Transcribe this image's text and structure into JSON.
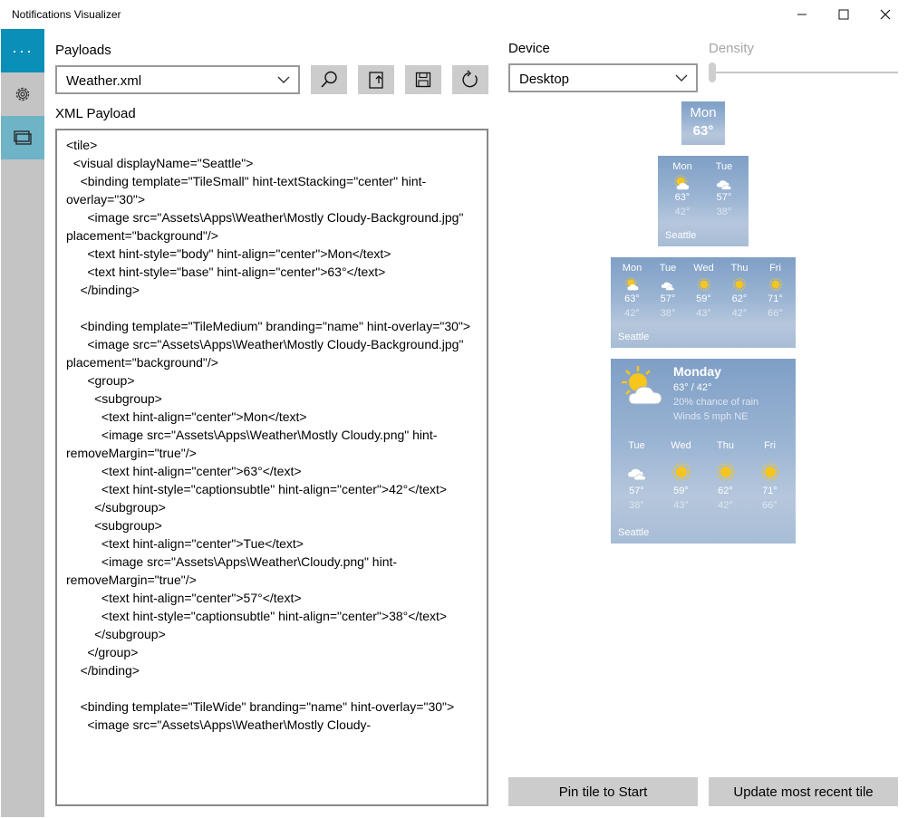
{
  "window": {
    "title": "Notifications Visualizer",
    "controls": {
      "minimize": "—",
      "maximize": "☐",
      "close": "✕"
    }
  },
  "sidebar": {
    "more_label": "···",
    "items": [
      {
        "icon": "gear-icon"
      },
      {
        "icon": "tiles-icon"
      }
    ]
  },
  "payloads": {
    "label": "Payloads",
    "selected": "Weather.xml",
    "xml_label": "XML Payload"
  },
  "device": {
    "label": "Device",
    "selected": "Desktop",
    "density_label": "Density"
  },
  "editor_lines": [
    "<tile>",
    "  <visual displayName=\"Seattle\">",
    "    <binding template=\"TileSmall\" hint-textStacking=\"center\" hint-overlay=\"30\">",
    "      <image src=\"Assets\\Apps\\Weather\\Mostly Cloudy-Background.jpg\" placement=\"background\"/>",
    "      <text hint-style=\"body\" hint-align=\"center\">Mon</text>",
    "      <text hint-style=\"base\" hint-align=\"center\">63°</text>",
    "    </binding>",
    "",
    "    <binding template=\"TileMedium\" branding=\"name\" hint-overlay=\"30\">",
    "      <image src=\"Assets\\Apps\\Weather\\Mostly Cloudy-Background.jpg\" placement=\"background\"/>",
    "      <group>",
    "        <subgroup>",
    "          <text hint-align=\"center\">Mon</text>",
    "          <image src=\"Assets\\Apps\\Weather\\Mostly Cloudy.png\" hint-removeMargin=\"true\"/>",
    "          <text hint-align=\"center\">63°</text>",
    "          <text hint-style=\"captionsubtle\" hint-align=\"center\">42°</text>",
    "        </subgroup>",
    "        <subgroup>",
    "          <text hint-align=\"center\">Tue</text>",
    "          <image src=\"Assets\\Apps\\Weather\\Cloudy.png\" hint-removeMargin=\"true\"/>",
    "          <text hint-align=\"center\">57°</text>",
    "          <text hint-style=\"captionsubtle\" hint-align=\"center\">38°</text>",
    "        </subgroup>",
    "      </group>",
    "    </binding>",
    "",
    "    <binding template=\"TileWide\" branding=\"name\" hint-overlay=\"30\">",
    "      <image src=\"Assets\\Apps\\Weather\\Mostly Cloudy-"
  ],
  "tiles": {
    "small": {
      "day": "Mon",
      "temp": "63°"
    },
    "medium": {
      "days": [
        {
          "day": "Mon",
          "icon": "partly-cloudy-icon",
          "high": "63°",
          "low": "42°"
        },
        {
          "day": "Tue",
          "icon": "cloudy-icon",
          "high": "57°",
          "low": "38°"
        }
      ],
      "branding": "Seattle"
    },
    "wide": {
      "days": [
        {
          "day": "Mon",
          "icon": "partly-cloudy-icon",
          "high": "63°",
          "low": "42°"
        },
        {
          "day": "Tue",
          "icon": "cloudy-icon",
          "high": "57°",
          "low": "38°"
        },
        {
          "day": "Wed",
          "icon": "sunny-icon",
          "high": "59°",
          "low": "43°"
        },
        {
          "day": "Thu",
          "icon": "sunny-icon",
          "high": "62°",
          "low": "42°"
        },
        {
          "day": "Fri",
          "icon": "sunny-icon",
          "high": "71°",
          "low": "66°"
        }
      ],
      "branding": "Seattle"
    },
    "large": {
      "title": "Monday",
      "line1": "63° / 42°",
      "line2": "20% chance of rain",
      "line3": "Winds 5 mph NE",
      "days": [
        {
          "day": "Tue",
          "icon": "cloudy-icon",
          "high": "57°",
          "low": "38°"
        },
        {
          "day": "Wed",
          "icon": "sunny-icon",
          "high": "59°",
          "low": "43°"
        },
        {
          "day": "Thu",
          "icon": "sunny-icon",
          "high": "62°",
          "low": "42°"
        },
        {
          "day": "Fri",
          "icon": "sunny-icon",
          "high": "71°",
          "low": "66°"
        }
      ],
      "branding": "Seattle"
    }
  },
  "buttons": {
    "pin": "Pin tile to Start",
    "update": "Update most recent tile"
  },
  "colors": {
    "accent": "#0a8fb8",
    "sidebar": "#c4c4c4",
    "selected": "#6fb3c7",
    "sun": "#f7c51c"
  }
}
